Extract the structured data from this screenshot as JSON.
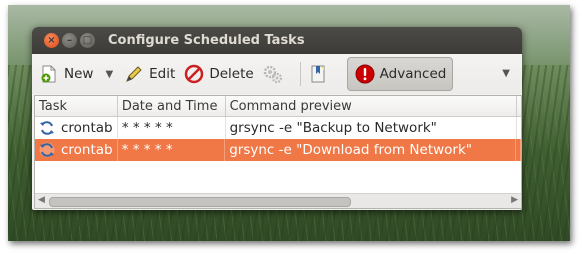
{
  "window": {
    "title": "Configure Scheduled Tasks"
  },
  "toolbar": {
    "new_label": "New",
    "edit_label": "Edit",
    "delete_label": "Delete",
    "advanced_label": "Advanced"
  },
  "table": {
    "columns": [
      "Task",
      "Date and Time",
      "Command preview"
    ],
    "rows": [
      {
        "task": "crontab",
        "datetime": "* * * * *",
        "command": "grsync -e \"Backup to Network\"",
        "selected": false
      },
      {
        "task": "crontab",
        "datetime": "* * * * *",
        "command": "grsync -e \"Download from Network\"",
        "selected": true
      }
    ]
  },
  "colors": {
    "selection": "#f07746",
    "titlebar": "#3c3b37",
    "close_button": "#e05a24"
  },
  "icons": [
    "close-icon",
    "minimize-icon",
    "maximize-icon",
    "new-document-icon",
    "edit-pencil-icon",
    "delete-stop-icon",
    "gears-icon",
    "bookmark-icon",
    "warning-icon",
    "refresh-icon"
  ]
}
